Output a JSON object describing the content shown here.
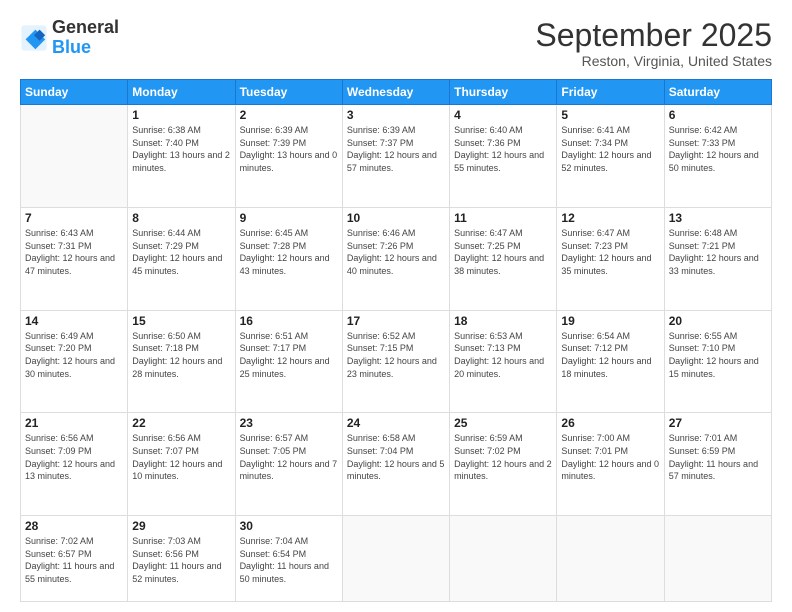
{
  "logo": {
    "line1": "General",
    "line2": "Blue"
  },
  "title": "September 2025",
  "subtitle": "Reston, Virginia, United States",
  "days_of_week": [
    "Sunday",
    "Monday",
    "Tuesday",
    "Wednesday",
    "Thursday",
    "Friday",
    "Saturday"
  ],
  "weeks": [
    [
      null,
      {
        "num": "1",
        "sunrise": "6:38 AM",
        "sunset": "7:40 PM",
        "daylight": "13 hours and 2 minutes."
      },
      {
        "num": "2",
        "sunrise": "6:39 AM",
        "sunset": "7:39 PM",
        "daylight": "13 hours and 0 minutes."
      },
      {
        "num": "3",
        "sunrise": "6:39 AM",
        "sunset": "7:37 PM",
        "daylight": "12 hours and 57 minutes."
      },
      {
        "num": "4",
        "sunrise": "6:40 AM",
        "sunset": "7:36 PM",
        "daylight": "12 hours and 55 minutes."
      },
      {
        "num": "5",
        "sunrise": "6:41 AM",
        "sunset": "7:34 PM",
        "daylight": "12 hours and 52 minutes."
      },
      {
        "num": "6",
        "sunrise": "6:42 AM",
        "sunset": "7:33 PM",
        "daylight": "12 hours and 50 minutes."
      }
    ],
    [
      {
        "num": "7",
        "sunrise": "6:43 AM",
        "sunset": "7:31 PM",
        "daylight": "12 hours and 47 minutes."
      },
      {
        "num": "8",
        "sunrise": "6:44 AM",
        "sunset": "7:29 PM",
        "daylight": "12 hours and 45 minutes."
      },
      {
        "num": "9",
        "sunrise": "6:45 AM",
        "sunset": "7:28 PM",
        "daylight": "12 hours and 43 minutes."
      },
      {
        "num": "10",
        "sunrise": "6:46 AM",
        "sunset": "7:26 PM",
        "daylight": "12 hours and 40 minutes."
      },
      {
        "num": "11",
        "sunrise": "6:47 AM",
        "sunset": "7:25 PM",
        "daylight": "12 hours and 38 minutes."
      },
      {
        "num": "12",
        "sunrise": "6:47 AM",
        "sunset": "7:23 PM",
        "daylight": "12 hours and 35 minutes."
      },
      {
        "num": "13",
        "sunrise": "6:48 AM",
        "sunset": "7:21 PM",
        "daylight": "12 hours and 33 minutes."
      }
    ],
    [
      {
        "num": "14",
        "sunrise": "6:49 AM",
        "sunset": "7:20 PM",
        "daylight": "12 hours and 30 minutes."
      },
      {
        "num": "15",
        "sunrise": "6:50 AM",
        "sunset": "7:18 PM",
        "daylight": "12 hours and 28 minutes."
      },
      {
        "num": "16",
        "sunrise": "6:51 AM",
        "sunset": "7:17 PM",
        "daylight": "12 hours and 25 minutes."
      },
      {
        "num": "17",
        "sunrise": "6:52 AM",
        "sunset": "7:15 PM",
        "daylight": "12 hours and 23 minutes."
      },
      {
        "num": "18",
        "sunrise": "6:53 AM",
        "sunset": "7:13 PM",
        "daylight": "12 hours and 20 minutes."
      },
      {
        "num": "19",
        "sunrise": "6:54 AM",
        "sunset": "7:12 PM",
        "daylight": "12 hours and 18 minutes."
      },
      {
        "num": "20",
        "sunrise": "6:55 AM",
        "sunset": "7:10 PM",
        "daylight": "12 hours and 15 minutes."
      }
    ],
    [
      {
        "num": "21",
        "sunrise": "6:56 AM",
        "sunset": "7:09 PM",
        "daylight": "12 hours and 13 minutes."
      },
      {
        "num": "22",
        "sunrise": "6:56 AM",
        "sunset": "7:07 PM",
        "daylight": "12 hours and 10 minutes."
      },
      {
        "num": "23",
        "sunrise": "6:57 AM",
        "sunset": "7:05 PM",
        "daylight": "12 hours and 7 minutes."
      },
      {
        "num": "24",
        "sunrise": "6:58 AM",
        "sunset": "7:04 PM",
        "daylight": "12 hours and 5 minutes."
      },
      {
        "num": "25",
        "sunrise": "6:59 AM",
        "sunset": "7:02 PM",
        "daylight": "12 hours and 2 minutes."
      },
      {
        "num": "26",
        "sunrise": "7:00 AM",
        "sunset": "7:01 PM",
        "daylight": "12 hours and 0 minutes."
      },
      {
        "num": "27",
        "sunrise": "7:01 AM",
        "sunset": "6:59 PM",
        "daylight": "11 hours and 57 minutes."
      }
    ],
    [
      {
        "num": "28",
        "sunrise": "7:02 AM",
        "sunset": "6:57 PM",
        "daylight": "11 hours and 55 minutes."
      },
      {
        "num": "29",
        "sunrise": "7:03 AM",
        "sunset": "6:56 PM",
        "daylight": "11 hours and 52 minutes."
      },
      {
        "num": "30",
        "sunrise": "7:04 AM",
        "sunset": "6:54 PM",
        "daylight": "11 hours and 50 minutes."
      },
      null,
      null,
      null,
      null
    ]
  ]
}
